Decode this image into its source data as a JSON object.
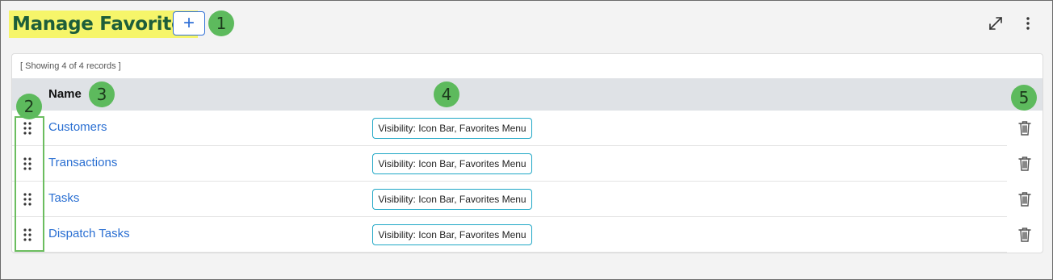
{
  "page": {
    "title": "Manage Favorites",
    "add_label": "+",
    "records_text": "[ Showing 4 of 4 records ]"
  },
  "table": {
    "columns": {
      "name": "Name"
    },
    "rows": [
      {
        "name": "Customers",
        "visibility": "Visibility: Icon Bar, Favorites Menu"
      },
      {
        "name": "Transactions",
        "visibility": "Visibility: Icon Bar, Favorites Menu"
      },
      {
        "name": "Tasks",
        "visibility": "Visibility: Icon Bar, Favorites Menu"
      },
      {
        "name": "Dispatch Tasks",
        "visibility": "Visibility: Icon Bar, Favorites Menu"
      }
    ]
  },
  "callouts": [
    "1",
    "2",
    "3",
    "4",
    "5"
  ],
  "icons": {
    "add": "plus-icon",
    "expand": "expand-icon",
    "menu": "kebab-menu-icon",
    "drag": "drag-handle-icon",
    "delete": "trash-icon"
  },
  "colors": {
    "title_highlight": "#f6f56a",
    "title_text": "#1d5e3a",
    "link": "#2a6fd2",
    "chip_border": "#1fa7c6",
    "callout": "#5dba5d",
    "header_bg": "#dfe2e6"
  }
}
